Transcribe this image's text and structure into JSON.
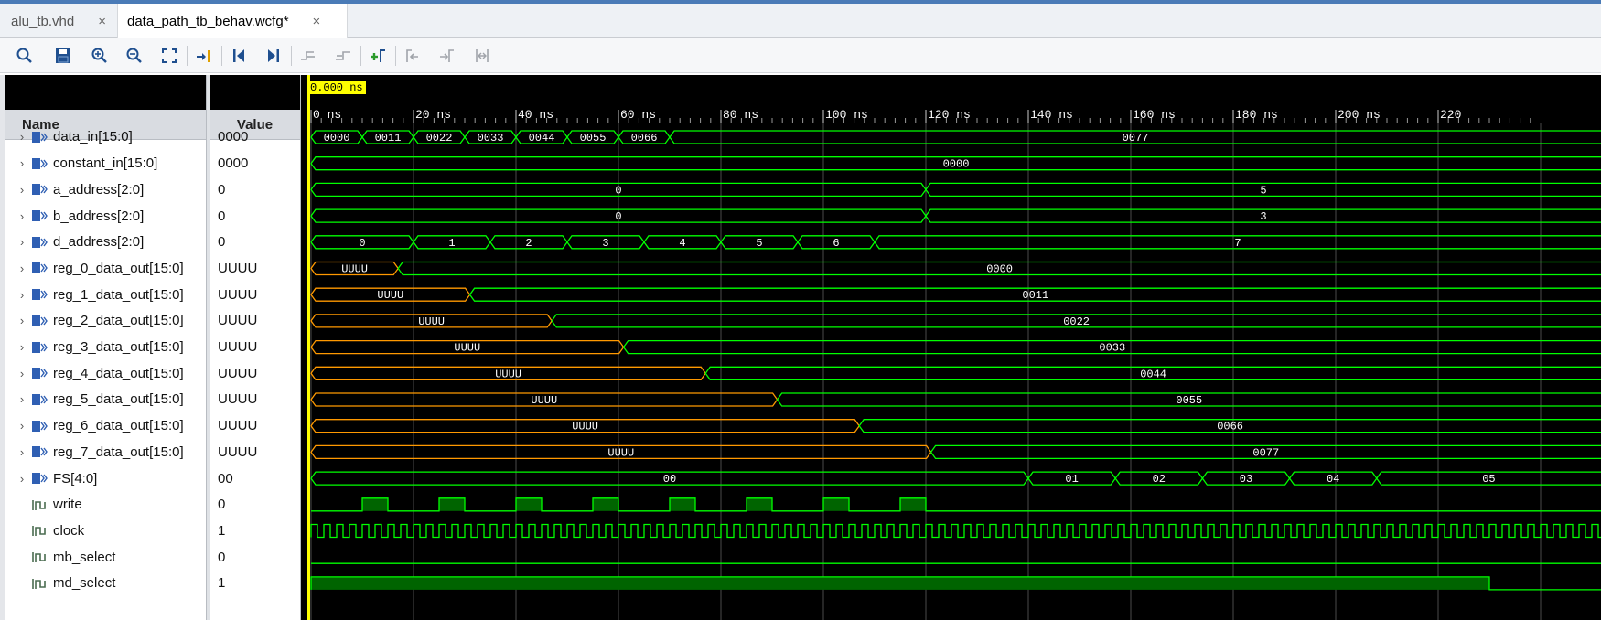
{
  "tabs": [
    {
      "label": "alu_tb.vhd",
      "close": "×",
      "active": false
    },
    {
      "label": "data_path_tb_behav.wcfg*",
      "close": "×",
      "active": true
    }
  ],
  "toolbar": {
    "icons": [
      "search-icon",
      "save-icon",
      "zoom-in-icon",
      "zoom-out-icon",
      "zoom-fit-icon",
      "go-to-cursor-icon",
      "go-to-time-zero-icon",
      "go-to-last-time-icon",
      "previous-transition-icon",
      "next-transition-icon",
      "add-marker-icon",
      "previous-marker-icon",
      "next-marker-icon",
      "swap-cursors-icon"
    ]
  },
  "headers": {
    "name": "Name",
    "value": "Value"
  },
  "cursor": {
    "label": "0.000 ns",
    "color": "#ffff00"
  },
  "ruler": {
    "unit": "ns",
    "major_ticks": [
      "0 ns",
      "20 ns",
      "40 ns",
      "60 ns",
      "80 ns",
      "100 ns",
      "120 ns",
      "140 ns",
      "160 ns",
      "180 ns",
      "200 ns",
      "220"
    ],
    "ns_per_major": 20
  },
  "colors": {
    "wave_green": "#00ff00",
    "wave_undefined": "#ff9900",
    "wave_fill": "#006400",
    "background": "#000000",
    "cursor": "#ffff00",
    "bus_icon": "#2f5fb3",
    "text": "#ffffff"
  },
  "signals": [
    {
      "name": "data_in[15:0]",
      "value": "0000",
      "kind": "bus",
      "segments": [
        {
          "start": 0,
          "label": "0000"
        },
        {
          "start": 10,
          "label": "0011"
        },
        {
          "start": 20,
          "label": "0022"
        },
        {
          "start": 30,
          "label": "0033"
        },
        {
          "start": 40,
          "label": "0044"
        },
        {
          "start": 50,
          "label": "0055"
        },
        {
          "start": 60,
          "label": "0066"
        },
        {
          "start": 70,
          "label": "0077"
        }
      ]
    },
    {
      "name": "constant_in[15:0]",
      "value": "0000",
      "kind": "bus",
      "segments": [
        {
          "start": 0,
          "label": "0000"
        }
      ]
    },
    {
      "name": "a_address[2:0]",
      "value": "0",
      "kind": "bus",
      "segments": [
        {
          "start": 0,
          "label": "0"
        },
        {
          "start": 120,
          "label": "5"
        }
      ]
    },
    {
      "name": "b_address[2:0]",
      "value": "0",
      "kind": "bus",
      "segments": [
        {
          "start": 0,
          "label": "0"
        },
        {
          "start": 120,
          "label": "3"
        }
      ]
    },
    {
      "name": "d_address[2:0]",
      "value": "0",
      "kind": "bus",
      "segments": [
        {
          "start": 0,
          "label": "0"
        },
        {
          "start": 20,
          "label": "1"
        },
        {
          "start": 35,
          "label": "2"
        },
        {
          "start": 50,
          "label": "3"
        },
        {
          "start": 65,
          "label": "4"
        },
        {
          "start": 80,
          "label": "5"
        },
        {
          "start": 95,
          "label": "6"
        },
        {
          "start": 110,
          "label": "7"
        }
      ]
    },
    {
      "name": "reg_0_data_out[15:0]",
      "value": "UUUU",
      "kind": "bus",
      "segments": [
        {
          "start": 0,
          "label": "UUUU",
          "undefined": true
        },
        {
          "start": 17,
          "label": "0000"
        }
      ]
    },
    {
      "name": "reg_1_data_out[15:0]",
      "value": "UUUU",
      "kind": "bus",
      "segments": [
        {
          "start": 0,
          "label": "UUUU",
          "undefined": true
        },
        {
          "start": 31,
          "label": "0011"
        }
      ]
    },
    {
      "name": "reg_2_data_out[15:0]",
      "value": "UUUU",
      "kind": "bus",
      "segments": [
        {
          "start": 0,
          "label": "UUUU",
          "undefined": true
        },
        {
          "start": 47,
          "label": "0022"
        }
      ]
    },
    {
      "name": "reg_3_data_out[15:0]",
      "value": "UUUU",
      "kind": "bus",
      "segments": [
        {
          "start": 0,
          "label": "UUUU",
          "undefined": true
        },
        {
          "start": 61,
          "label": "0033"
        }
      ]
    },
    {
      "name": "reg_4_data_out[15:0]",
      "value": "UUUU",
      "kind": "bus",
      "segments": [
        {
          "start": 0,
          "label": "UUUU",
          "undefined": true
        },
        {
          "start": 77,
          "label": "0044"
        }
      ]
    },
    {
      "name": "reg_5_data_out[15:0]",
      "value": "UUUU",
      "kind": "bus",
      "segments": [
        {
          "start": 0,
          "label": "UUUU",
          "undefined": true
        },
        {
          "start": 91,
          "label": "0055"
        }
      ]
    },
    {
      "name": "reg_6_data_out[15:0]",
      "value": "UUUU",
      "kind": "bus",
      "segments": [
        {
          "start": 0,
          "label": "UUUU",
          "undefined": true
        },
        {
          "start": 107,
          "label": "0066"
        }
      ]
    },
    {
      "name": "reg_7_data_out[15:0]",
      "value": "UUUU",
      "kind": "bus",
      "segments": [
        {
          "start": 0,
          "label": "UUUU",
          "undefined": true
        },
        {
          "start": 121,
          "label": "0077"
        }
      ]
    },
    {
      "name": "FS[4:0]",
      "value": "00",
      "kind": "bus",
      "segments": [
        {
          "start": 0,
          "label": "00"
        },
        {
          "start": 140,
          "label": "01"
        },
        {
          "start": 157,
          "label": "02"
        },
        {
          "start": 174,
          "label": "03"
        },
        {
          "start": 191,
          "label": "04"
        },
        {
          "start": 208,
          "label": "05"
        }
      ]
    },
    {
      "name": "write",
      "value": "0",
      "kind": "bit",
      "pulses": [
        [
          10,
          15
        ],
        [
          25,
          30
        ],
        [
          40,
          45
        ],
        [
          55,
          60
        ],
        [
          70,
          75
        ],
        [
          85,
          90
        ],
        [
          100,
          105
        ],
        [
          115,
          120
        ]
      ]
    },
    {
      "name": "clock",
      "value": "1",
      "kind": "clock",
      "period": 2.5
    },
    {
      "name": "mb_select",
      "value": "0",
      "kind": "bit",
      "pulses": []
    },
    {
      "name": "md_select",
      "value": "1",
      "kind": "bit",
      "pulses": [
        [
          0,
          230
        ]
      ]
    }
  ]
}
